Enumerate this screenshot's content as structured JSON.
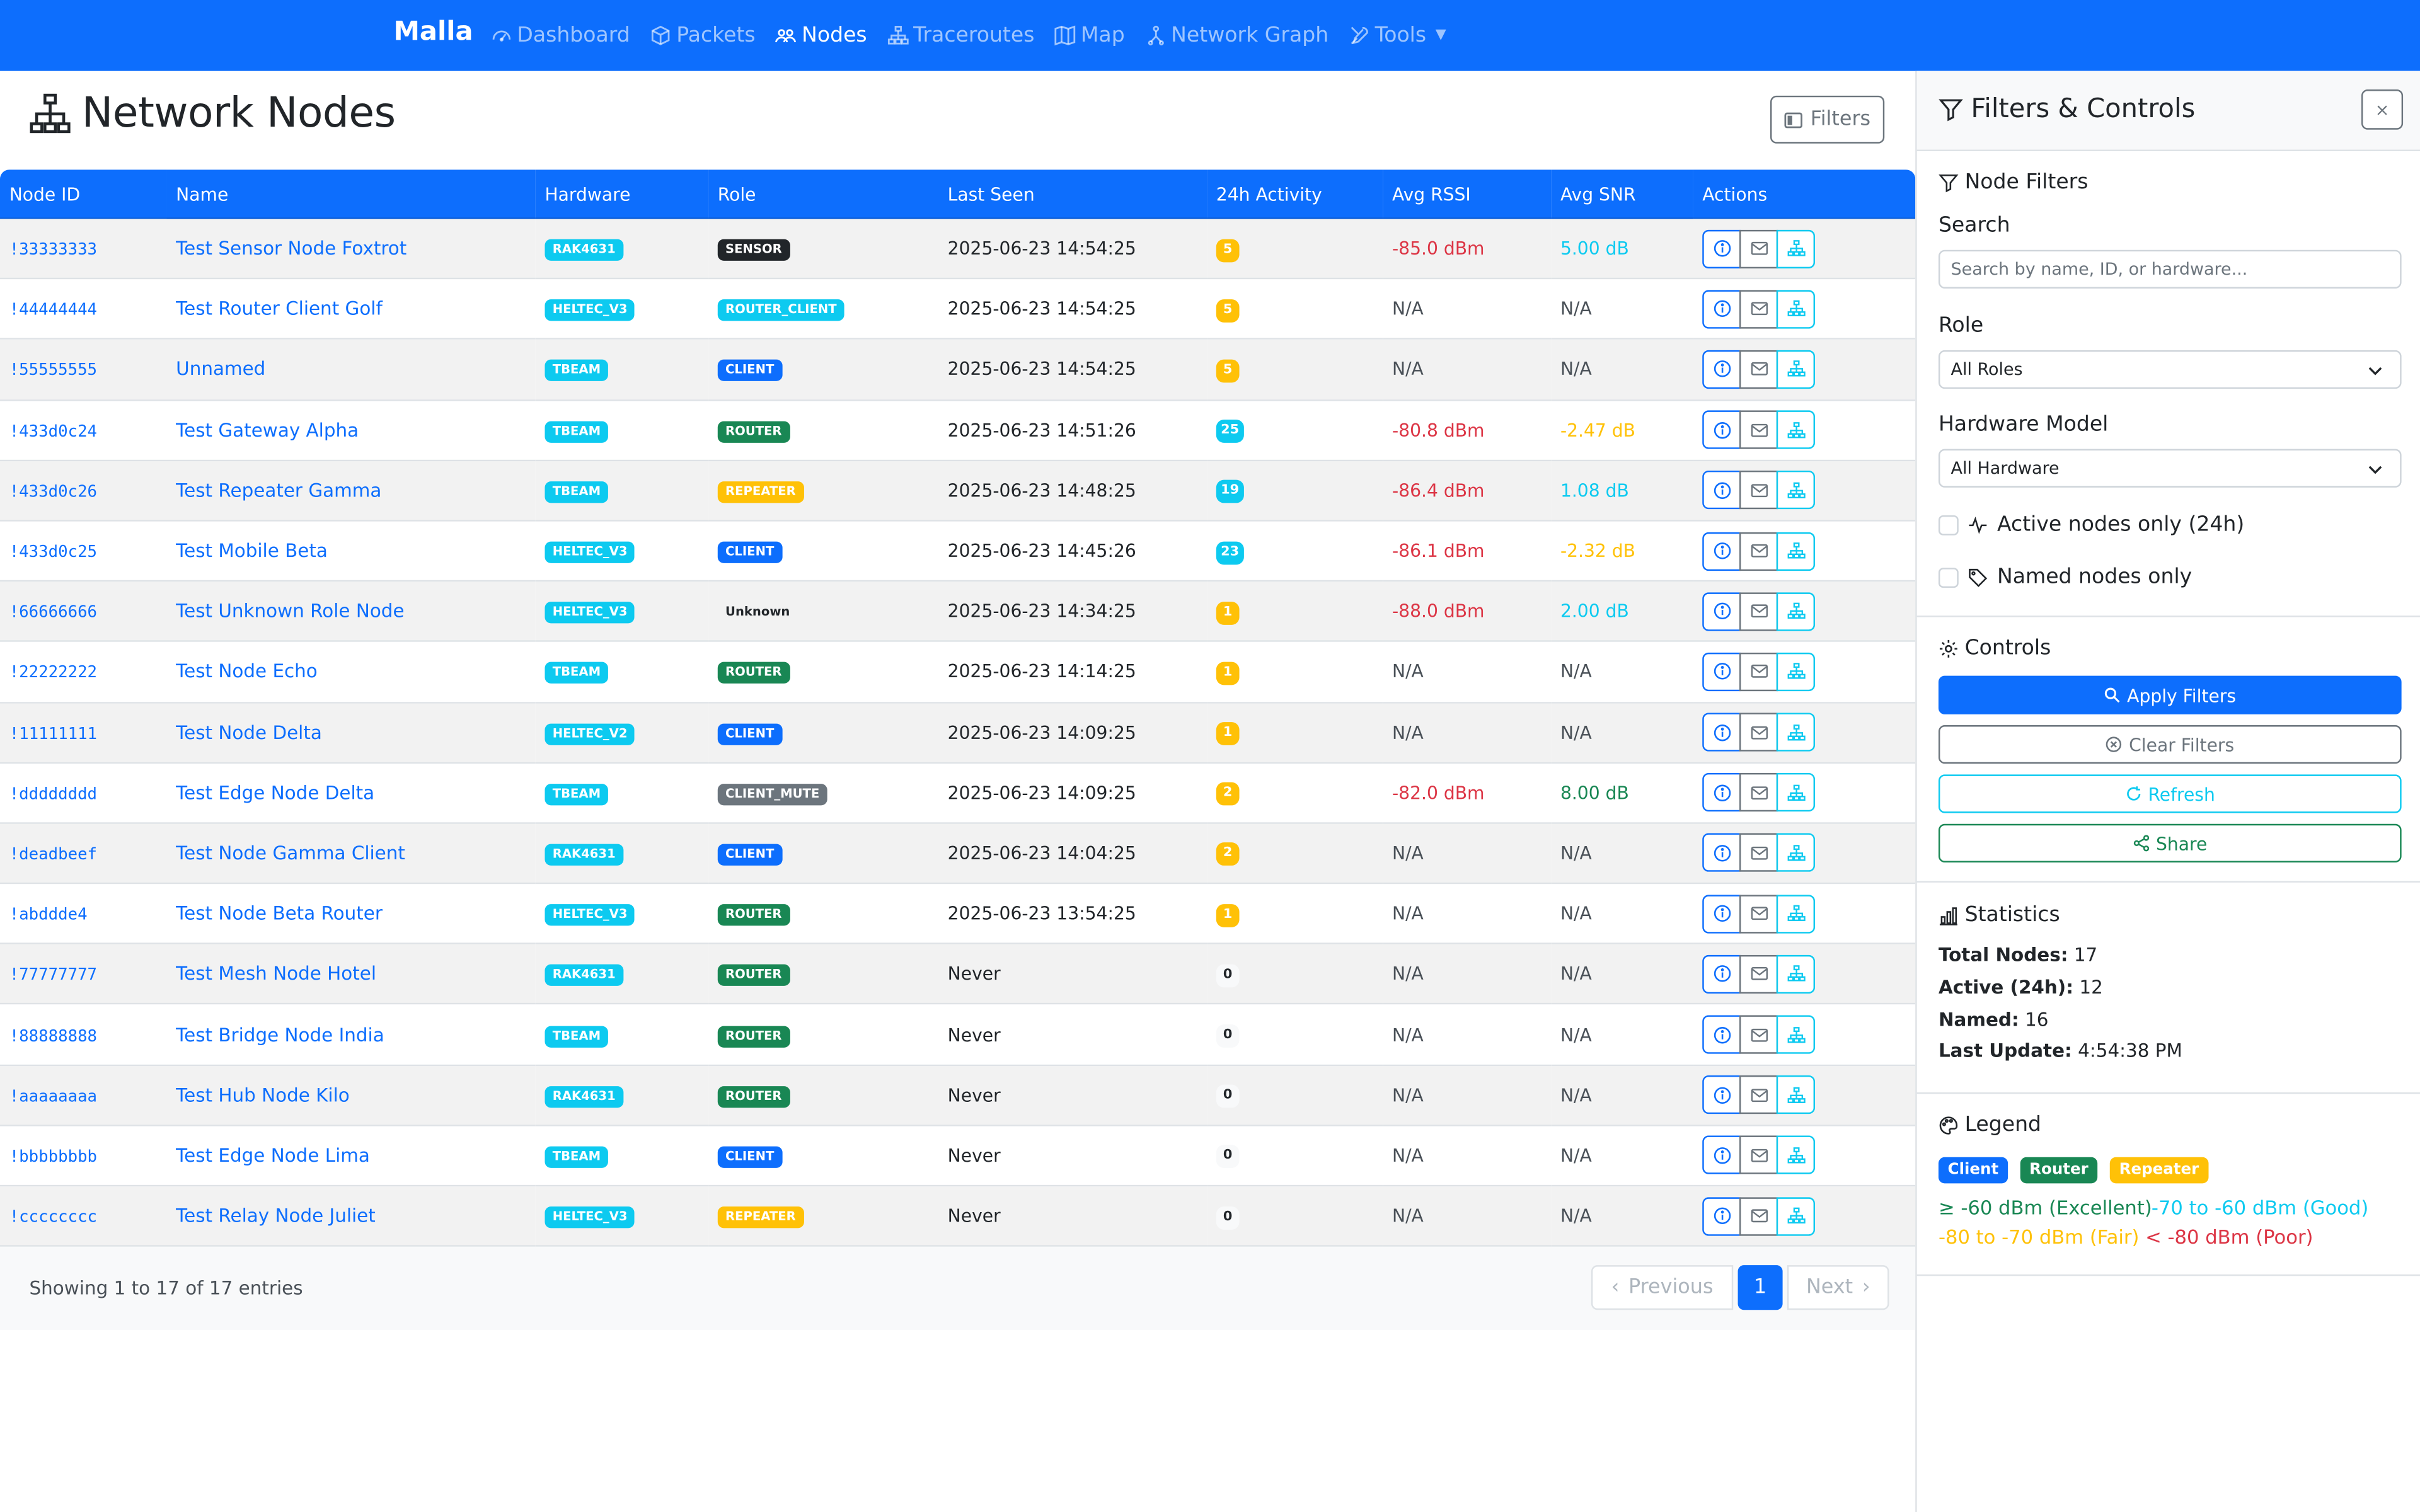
{
  "nav": {
    "brand": "Malla",
    "items": [
      {
        "label": "Dashboard",
        "icon": "speedometer-icon"
      },
      {
        "label": "Packets",
        "icon": "box-icon"
      },
      {
        "label": "Nodes",
        "icon": "people-icon"
      },
      {
        "label": "Traceroutes",
        "icon": "diagram-icon"
      },
      {
        "label": "Map",
        "icon": "map-icon"
      },
      {
        "label": "Network Graph",
        "icon": "graph-icon"
      },
      {
        "label": "Tools",
        "icon": "tools-icon"
      }
    ],
    "active": "Nodes"
  },
  "page": {
    "title": "Network Nodes",
    "filters_button": "Filters"
  },
  "table": {
    "columns": [
      "Node ID",
      "Name",
      "Hardware",
      "Role",
      "Last Seen",
      "24h Activity",
      "Avg RSSI",
      "Avg SNR",
      "Actions"
    ],
    "rows": [
      {
        "id": "!33333333",
        "name": "Test Sensor Node Foxtrot",
        "hardware": "RAK4631",
        "role": "SENSOR",
        "last_seen": "2025-06-23 14:54:25",
        "activity": "5",
        "rssi": "-85.0 dBm",
        "snr": "5.00 dB"
      },
      {
        "id": "!44444444",
        "name": "Test Router Client Golf",
        "hardware": "HELTEC_V3",
        "role": "ROUTER_CLIENT",
        "last_seen": "2025-06-23 14:54:25",
        "activity": "5",
        "rssi": "N/A",
        "snr": "N/A"
      },
      {
        "id": "!55555555",
        "name": "Unnamed",
        "hardware": "TBEAM",
        "role": "CLIENT",
        "last_seen": "2025-06-23 14:54:25",
        "activity": "5",
        "rssi": "N/A",
        "snr": "N/A"
      },
      {
        "id": "!433d0c24",
        "name": "Test Gateway Alpha",
        "hardware": "TBEAM",
        "role": "ROUTER",
        "last_seen": "2025-06-23 14:51:26",
        "activity": "25",
        "rssi": "-80.8 dBm",
        "snr": "-2.47 dB"
      },
      {
        "id": "!433d0c26",
        "name": "Test Repeater Gamma",
        "hardware": "TBEAM",
        "role": "REPEATER",
        "last_seen": "2025-06-23 14:48:25",
        "activity": "19",
        "rssi": "-86.4 dBm",
        "snr": "1.08 dB"
      },
      {
        "id": "!433d0c25",
        "name": "Test Mobile Beta",
        "hardware": "HELTEC_V3",
        "role": "CLIENT",
        "last_seen": "2025-06-23 14:45:26",
        "activity": "23",
        "rssi": "-86.1 dBm",
        "snr": "-2.32 dB"
      },
      {
        "id": "!66666666",
        "name": "Test Unknown Role Node",
        "hardware": "HELTEC_V3",
        "role": "Unknown",
        "last_seen": "2025-06-23 14:34:25",
        "activity": "1",
        "rssi": "-88.0 dBm",
        "snr": "2.00 dB"
      },
      {
        "id": "!22222222",
        "name": "Test Node Echo",
        "hardware": "TBEAM",
        "role": "ROUTER",
        "last_seen": "2025-06-23 14:14:25",
        "activity": "1",
        "rssi": "N/A",
        "snr": "N/A"
      },
      {
        "id": "!11111111",
        "name": "Test Node Delta",
        "hardware": "HELTEC_V2",
        "role": "CLIENT",
        "last_seen": "2025-06-23 14:09:25",
        "activity": "1",
        "rssi": "N/A",
        "snr": "N/A"
      },
      {
        "id": "!dddddddd",
        "name": "Test Edge Node Delta",
        "hardware": "TBEAM",
        "role": "CLIENT_MUTE",
        "last_seen": "2025-06-23 14:09:25",
        "activity": "2",
        "rssi": "-82.0 dBm",
        "snr": "8.00 dB"
      },
      {
        "id": "!deadbeef",
        "name": "Test Node Gamma Client",
        "hardware": "RAK4631",
        "role": "CLIENT",
        "last_seen": "2025-06-23 14:04:25",
        "activity": "2",
        "rssi": "N/A",
        "snr": "N/A"
      },
      {
        "id": "!abddde4",
        "name": "Test Node Beta Router",
        "hardware": "HELTEC_V3",
        "role": "ROUTER",
        "last_seen": "2025-06-23 13:54:25",
        "activity": "1",
        "rssi": "N/A",
        "snr": "N/A"
      },
      {
        "id": "!77777777",
        "name": "Test Mesh Node Hotel",
        "hardware": "RAK4631",
        "role": "ROUTER",
        "last_seen": "Never",
        "activity": "0",
        "rssi": "N/A",
        "snr": "N/A"
      },
      {
        "id": "!88888888",
        "name": "Test Bridge Node India",
        "hardware": "TBEAM",
        "role": "ROUTER",
        "last_seen": "Never",
        "activity": "0",
        "rssi": "N/A",
        "snr": "N/A"
      },
      {
        "id": "!aaaaaaaa",
        "name": "Test Hub Node Kilo",
        "hardware": "RAK4631",
        "role": "ROUTER",
        "last_seen": "Never",
        "activity": "0",
        "rssi": "N/A",
        "snr": "N/A"
      },
      {
        "id": "!bbbbbbbb",
        "name": "Test Edge Node Lima",
        "hardware": "TBEAM",
        "role": "CLIENT",
        "last_seen": "Never",
        "activity": "0",
        "rssi": "N/A",
        "snr": "N/A"
      },
      {
        "id": "!cccccccc",
        "name": "Test Relay Node Juliet",
        "hardware": "HELTEC_V3",
        "role": "REPEATER",
        "last_seen": "Never",
        "activity": "0",
        "rssi": "N/A",
        "snr": "N/A"
      }
    ],
    "showing": "Showing 1 to 17 of 17 entries",
    "pagination": {
      "previous": "Previous",
      "current": "1",
      "next": "Next"
    }
  },
  "sidebar": {
    "title": "Filters & Controls",
    "close": "×",
    "node_filters": {
      "title": "Node Filters",
      "search_label": "Search",
      "search_placeholder": "Search by name, ID, or hardware...",
      "role_label": "Role",
      "role_value": "All Roles",
      "hardware_label": "Hardware Model",
      "hardware_value": "All Hardware",
      "active_only": "Active nodes only (24h)",
      "named_only": "Named nodes only"
    },
    "controls": {
      "title": "Controls",
      "apply": "Apply Filters",
      "clear": "Clear Filters",
      "refresh": "Refresh",
      "share": "Share"
    },
    "statistics": {
      "title": "Statistics",
      "total_label": "Total Nodes:",
      "total_value": "17",
      "active_label": "Active (24h):",
      "active_value": "12",
      "named_label": "Named:",
      "named_value": "16",
      "update_label": "Last Update:",
      "update_value": "4:54:38 PM"
    },
    "legend": {
      "title": "Legend",
      "badges": [
        "Client",
        "Router",
        "Repeater"
      ],
      "excellent": "≥ -60 dBm (Excellent)",
      "good": "-70 to -60 dBm (Good)",
      "fair": "-80 to -70 dBm (Fair)",
      "poor": "< -80 dBm (Poor)"
    }
  },
  "colors": {
    "primary": "#0d6efd",
    "info": "#0dcaf0",
    "success": "#198754",
    "warning": "#ffc107",
    "danger": "#dc3545",
    "secondary": "#6c757d",
    "dark": "#212529"
  }
}
